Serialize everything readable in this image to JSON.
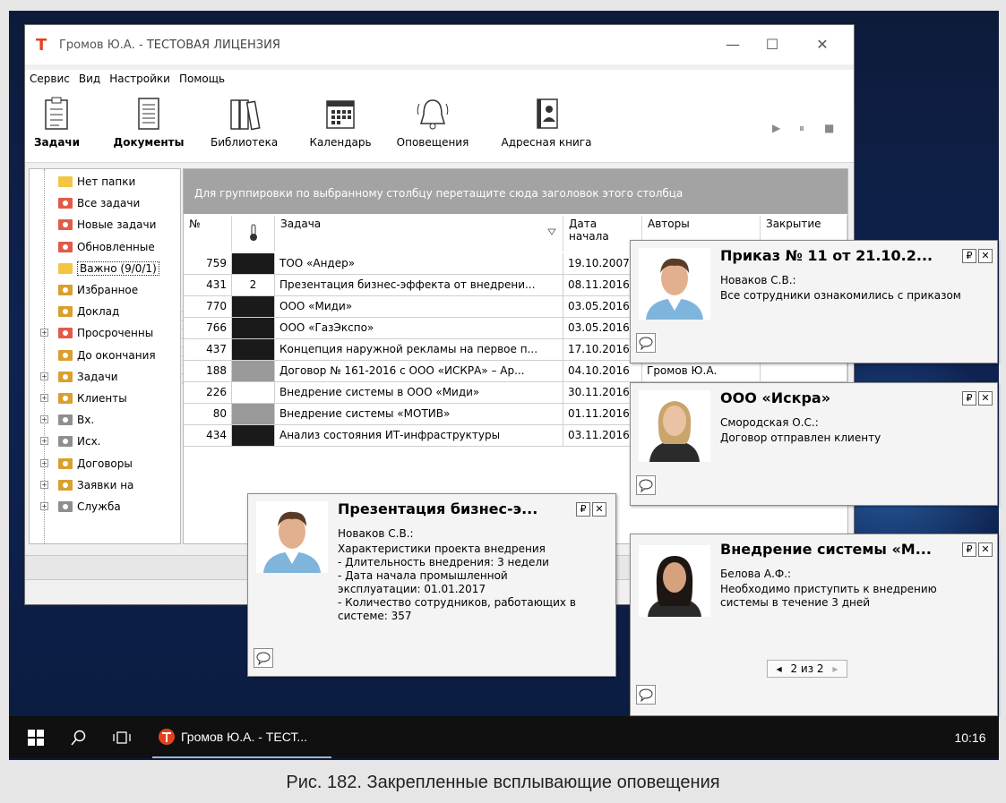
{
  "window": {
    "title_name": "Громов Ю.А. - ",
    "title_license": "ТЕСТОВАЯ ЛИЦЕНЗИЯ",
    "logo": "Т",
    "controls": {
      "minimize": "—",
      "maximize": "☐",
      "close": "✕"
    }
  },
  "menu": [
    "Сервис",
    "Вид",
    "Настройки",
    "Помощь"
  ],
  "toolbar": {
    "tools": [
      "Задачи",
      "Документы",
      "Библиотека",
      "Календарь",
      "Оповещения",
      "Адресная книга"
    ],
    "media": {
      "play": "▶",
      "pause": "⏸",
      "stop": "■"
    }
  },
  "tree": {
    "items": [
      {
        "label": "Нет папки",
        "color": "#f4c542"
      },
      {
        "label": "Все задачи",
        "color": "#e25b4a"
      },
      {
        "label": "Новые задачи",
        "color": "#e25b4a"
      },
      {
        "label": "Обновленные",
        "color": "#e25b4a"
      },
      {
        "label": "Важно (9/0/1)",
        "color": "#f4c542"
      },
      {
        "label": "Избранное",
        "color": "#d9a030"
      },
      {
        "label": "Доклад",
        "color": "#d9a030"
      },
      {
        "label": "Просроченны",
        "color": "#e25b4a"
      },
      {
        "label": "До окончания",
        "color": "#d9a030"
      },
      {
        "label": "Задачи",
        "color": "#d9a030"
      },
      {
        "label": "Клиенты",
        "color": "#d9a030"
      },
      {
        "label": "Вх.",
        "color": "#8f8f8f"
      },
      {
        "label": "Исх.",
        "color": "#8f8f8f"
      },
      {
        "label": "Договоры",
        "color": "#d9a030"
      },
      {
        "label": "Заявки на",
        "color": "#d9a030"
      },
      {
        "label": "Служба",
        "color": "#8f8f8f"
      }
    ]
  },
  "grid": {
    "group_hint": "Для группировки по выбранному столбцу перетащите сюда заголовок этого столбца",
    "headers": {
      "num": "№",
      "task": "Задача",
      "start_l1": "Дата",
      "start_l2": "начала",
      "authors": "Авторы",
      "closing": "Закрытие"
    },
    "rows": [
      {
        "num": "759",
        "prio": "",
        "prio_color": "#1a1a1a",
        "task": "ТОО «Андер»",
        "date": "19.10.2007",
        "author": ""
      },
      {
        "num": "431",
        "prio": "2",
        "prio_color": "#ffffff",
        "task": "Презентация бизнес-эффекта от внедрени...",
        "date": "08.11.2016",
        "author": ""
      },
      {
        "num": "770",
        "prio": "",
        "prio_color": "#1a1a1a",
        "task": "ООО «Миди»",
        "date": "03.05.2016",
        "author": ""
      },
      {
        "num": "766",
        "prio": "",
        "prio_color": "#1a1a1a",
        "task": "ООО «ГазЭкспо»",
        "date": "03.05.2016",
        "author": ""
      },
      {
        "num": "437",
        "prio": "",
        "prio_color": "#1a1a1a",
        "task": "Концепция наружной рекламы на первое п...",
        "date": "17.10.2016",
        "author": ""
      },
      {
        "num": "188",
        "prio": "",
        "prio_color": "#9a9a9a",
        "task": "Договор № 161-2016 с ООО «ИСКРА» – Ар...",
        "date": "04.10.2016",
        "author": "Громов Ю.А."
      },
      {
        "num": "226",
        "prio": "",
        "prio_color": "#ffffff",
        "task": "Внедрение системы в ООО «Миди»",
        "date": "30.11.2016",
        "author": ""
      },
      {
        "num": "80",
        "prio": "",
        "prio_color": "#9a9a9a",
        "task": "Внедрение системы «МОТИВ»",
        "date": "01.11.2016",
        "author": ""
      },
      {
        "num": "434",
        "prio": "",
        "prio_color": "#1a1a1a",
        "task": "Анализ состояния ИТ-инфраструктуры",
        "date": "03.11.2016",
        "author": ""
      }
    ]
  },
  "popups": [
    {
      "title": "Приказ № 11 от 21.10.2...",
      "author": "Новаков С.В.:",
      "body": "Все сотрудники ознакомились с приказом"
    },
    {
      "title": "ООО «Искра»",
      "author": "Смородская О.С.:",
      "body": "Договор отправлен клиенту"
    },
    {
      "title": "Внедрение системы «М...",
      "author": "Белова А.Ф.:",
      "body": "Необходимо приступить к внедрению\nсистемы в течение 3 дней",
      "pager": "2 из 2"
    },
    {
      "title": "Презентация бизнес-э...",
      "author": "Новаков С.В.:",
      "body": "Характеристики проекта внедрения\n- Длительность внедрения: 3 недели\n- Дата начала промышленной\nэксплуатации: 01.01.2017\n- Количество сотрудников, работающих в\nсистеме: 357"
    }
  ],
  "popup_controls": {
    "pin": "₽",
    "close": "✕",
    "pager_prev": "◂",
    "pager_next": "▸"
  },
  "taskbar": {
    "app_label": "Громов Ю.А. - ТЕСТ...",
    "time": "10:16"
  },
  "caption": "Рис. 182. Закрепленные всплывающие оповещения"
}
